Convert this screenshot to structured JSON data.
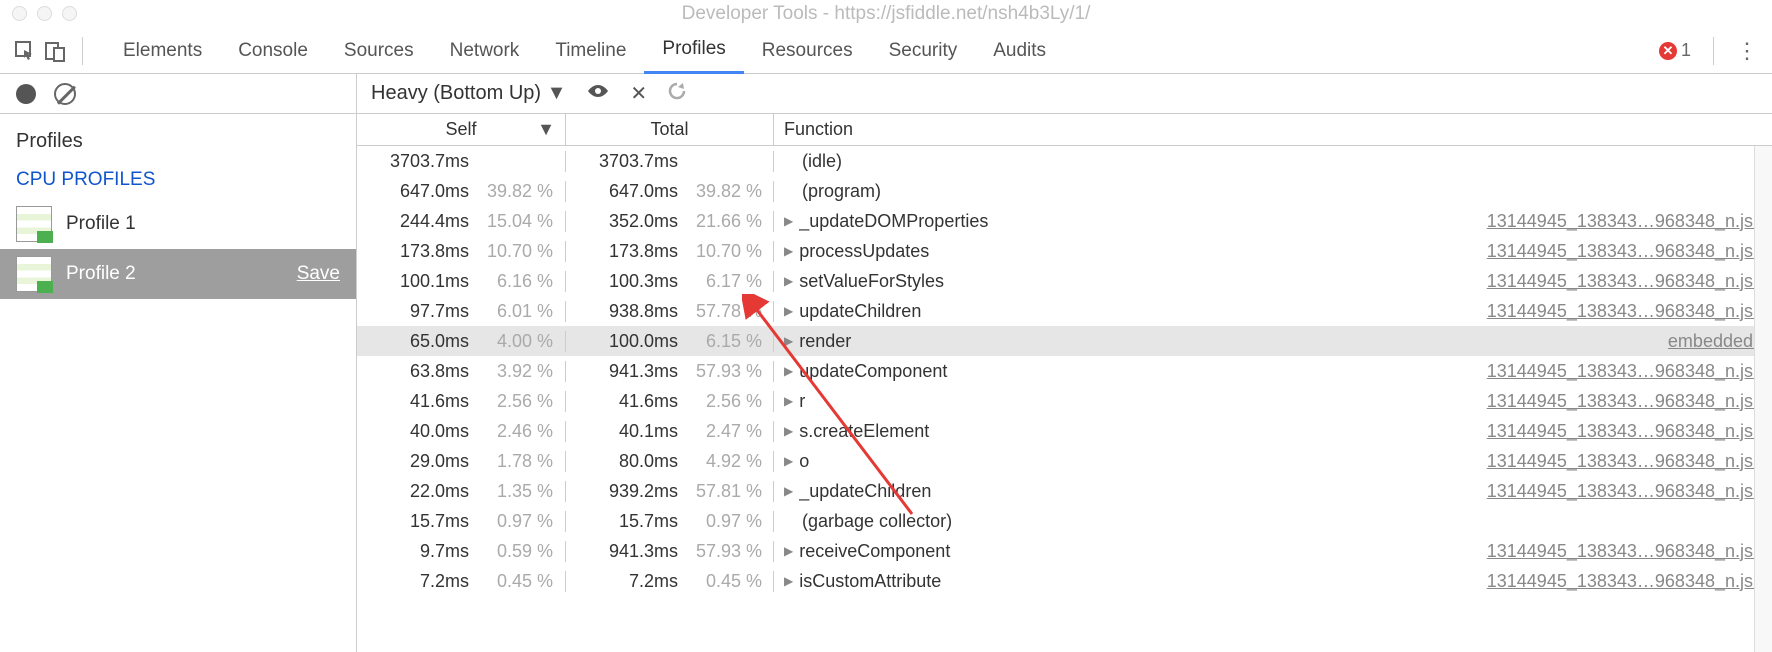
{
  "window": {
    "title": "Developer Tools - https://jsfiddle.net/nsh4b3Ly/1/"
  },
  "tabs": [
    "Elements",
    "Console",
    "Sources",
    "Network",
    "Timeline",
    "Profiles",
    "Resources",
    "Security",
    "Audits"
  ],
  "active_tab": "Profiles",
  "errors": {
    "count": "1"
  },
  "sidebar": {
    "title": "Profiles",
    "section": "CPU PROFILES",
    "items": [
      {
        "label": "Profile 1",
        "selected": false
      },
      {
        "label": "Profile 2",
        "selected": true,
        "save": "Save"
      }
    ]
  },
  "toolbar": {
    "view_mode": "Heavy (Bottom Up)"
  },
  "columns": {
    "self": "Self",
    "total": "Total",
    "fn": "Function"
  },
  "rows": [
    {
      "self_ms": "3703.7ms",
      "self_pct": "",
      "total_ms": "3703.7ms",
      "total_pct": "",
      "fn": "(idle)",
      "disc": false,
      "src": ""
    },
    {
      "self_ms": "647.0ms",
      "self_pct": "39.82 %",
      "total_ms": "647.0ms",
      "total_pct": "39.82 %",
      "fn": "(program)",
      "disc": false,
      "src": ""
    },
    {
      "self_ms": "244.4ms",
      "self_pct": "15.04 %",
      "total_ms": "352.0ms",
      "total_pct": "21.66 %",
      "fn": "_updateDOMProperties",
      "disc": true,
      "src": "13144945_138343…968348_n.js:"
    },
    {
      "self_ms": "173.8ms",
      "self_pct": "10.70 %",
      "total_ms": "173.8ms",
      "total_pct": "10.70 %",
      "fn": "processUpdates",
      "disc": true,
      "src": "13144945_138343…968348_n.js:"
    },
    {
      "self_ms": "100.1ms",
      "self_pct": "6.16 %",
      "total_ms": "100.3ms",
      "total_pct": "6.17 %",
      "fn": "setValueForStyles",
      "disc": true,
      "src": "13144945_138343…968348_n.js:"
    },
    {
      "self_ms": "97.7ms",
      "self_pct": "6.01 %",
      "total_ms": "938.8ms",
      "total_pct": "57.78 %",
      "fn": "updateChildren",
      "disc": true,
      "src": "13144945_138343…968348_n.js:"
    },
    {
      "self_ms": "65.0ms",
      "self_pct": "4.00 %",
      "total_ms": "100.0ms",
      "total_pct": "6.15 %",
      "fn": "render",
      "disc": true,
      "src": "embedded:",
      "hl": true
    },
    {
      "self_ms": "63.8ms",
      "self_pct": "3.92 %",
      "total_ms": "941.3ms",
      "total_pct": "57.93 %",
      "fn": "updateComponent",
      "disc": true,
      "src": "13144945_138343…968348_n.js:"
    },
    {
      "self_ms": "41.6ms",
      "self_pct": "2.56 %",
      "total_ms": "41.6ms",
      "total_pct": "2.56 %",
      "fn": "r",
      "disc": true,
      "src": "13144945_138343…968348_n.js:"
    },
    {
      "self_ms": "40.0ms",
      "self_pct": "2.46 %",
      "total_ms": "40.1ms",
      "total_pct": "2.47 %",
      "fn": "s.createElement",
      "disc": true,
      "src": "13144945_138343…968348_n.js:"
    },
    {
      "self_ms": "29.0ms",
      "self_pct": "1.78 %",
      "total_ms": "80.0ms",
      "total_pct": "4.92 %",
      "fn": "o",
      "disc": true,
      "src": "13144945_138343…968348_n.js:"
    },
    {
      "self_ms": "22.0ms",
      "self_pct": "1.35 %",
      "total_ms": "939.2ms",
      "total_pct": "57.81 %",
      "fn": "_updateChildren",
      "disc": true,
      "src": "13144945_138343…968348_n.js:"
    },
    {
      "self_ms": "15.7ms",
      "self_pct": "0.97 %",
      "total_ms": "15.7ms",
      "total_pct": "0.97 %",
      "fn": "(garbage collector)",
      "disc": false,
      "src": ""
    },
    {
      "self_ms": "9.7ms",
      "self_pct": "0.59 %",
      "total_ms": "941.3ms",
      "total_pct": "57.93 %",
      "fn": "receiveComponent",
      "disc": true,
      "src": "13144945_138343…968348_n.js:"
    },
    {
      "self_ms": "7.2ms",
      "self_pct": "0.45 %",
      "total_ms": "7.2ms",
      "total_pct": "0.45 %",
      "fn": "isCustomAttribute",
      "disc": true,
      "src": "13144945_138343…968348_n.js:"
    }
  ]
}
